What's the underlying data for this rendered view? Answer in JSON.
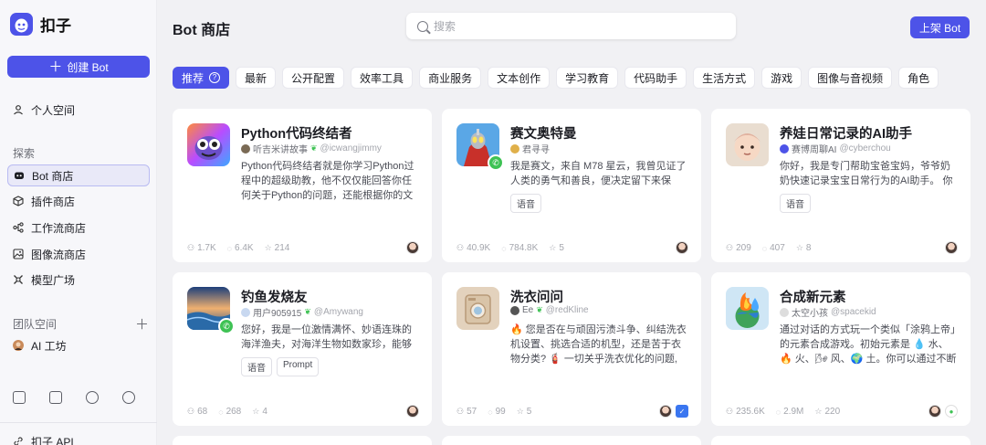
{
  "app": {
    "name": "扣子"
  },
  "sidebar": {
    "create_label": "创建 Bot",
    "personal_label": "个人空间",
    "explore_label": "探索",
    "explore_items": [
      {
        "label": "Bot 商店"
      },
      {
        "label": "插件商店"
      },
      {
        "label": "工作流商店"
      },
      {
        "label": "图像流商店"
      },
      {
        "label": "模型广场"
      }
    ],
    "team_label": "团队空间",
    "team_items": [
      {
        "label": "AI 工坊"
      }
    ],
    "bottom_link": "扣子 API"
  },
  "header": {
    "title": "Bot 商店",
    "search_placeholder": "搜索",
    "publish_label": "上架 Bot"
  },
  "tabs": [
    "推荐",
    "最新",
    "公开配置",
    "效率工具",
    "商业服务",
    "文本创作",
    "学习教育",
    "代码助手",
    "生活方式",
    "游戏",
    "图像与音视频",
    "角色"
  ],
  "cards": [
    {
      "title": "Python代码终结者",
      "author": "听吉米讲故事",
      "handle": "@icwangjimmy",
      "desc": "Python代码终结者就是你学习Python过程中的超级助教，他不仅仅能回答你任何关于Python的问题，还能根据你的文字…",
      "tags": [],
      "users": "1.7K",
      "chats": "6.4K",
      "stars": "214"
    },
    {
      "title": "赛文奥特曼",
      "author": "君寻寻",
      "handle": "",
      "desc": "我是赛文，来自 M78 星云，我曾见证了人类的勇气和善良，便决定留下来保护…",
      "tags": [
        "语音"
      ],
      "users": "40.9K",
      "chats": "784.8K",
      "stars": "5"
    },
    {
      "title": "养娃日常记录的AI助手",
      "author": "赛博周聊AI",
      "handle": "@cyberchou",
      "desc": "你好，我是专门帮助宝爸宝妈，爷爷奶奶快速记录宝宝日常行为的AI助手。 你可…",
      "tags": [
        "语音"
      ],
      "users": "209",
      "chats": "407",
      "stars": "8"
    },
    {
      "title": "钓鱼发烧友",
      "author": "用户905915",
      "handle": "@Amywang",
      "desc": "您好，我是一位激情满怀、妙语连珠的海洋渔夫，对海洋生物如数家珍，能够用…",
      "tags": [
        "语音",
        "Prompt"
      ],
      "users": "68",
      "chats": "268",
      "stars": "4"
    },
    {
      "title": "洗衣问问",
      "author": "Ee",
      "handle": "@redKline",
      "desc": "🔥 您是否在与顽固污渍斗争、纠结洗衣机设置、挑选合适的机型，还是苦于衣物分类? 🧯 一切关乎洗衣优化的问题, …",
      "tags": [],
      "users": "57",
      "chats": "99",
      "stars": "5"
    },
    {
      "title": "合成新元素",
      "author": "太空小孩",
      "handle": "@spacekid",
      "desc": "通过对话的方式玩一个类似「涂鸦上帝」的元素合成游戏。初始元素是 💧 水、🔥 火、🌬 风、🌍 土。你可以通过不断的…",
      "tags": [],
      "users": "235.6K",
      "chats": "2.9M",
      "stars": "220"
    }
  ],
  "colors": {
    "accent": "#4d53e8",
    "page_bg": "#f1f1f4"
  }
}
